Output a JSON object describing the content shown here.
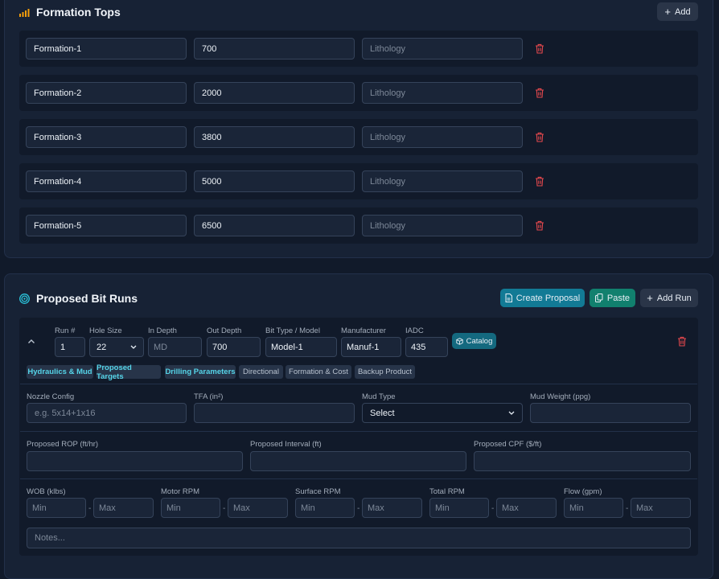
{
  "formation_tops": {
    "title": "Formation Tops",
    "add_label": "Add",
    "rows": [
      {
        "name": "Formation-1",
        "depth": "700",
        "lithology_placeholder": "Lithology"
      },
      {
        "name": "Formation-2",
        "depth": "2000",
        "lithology_placeholder": "Lithology"
      },
      {
        "name": "Formation-3",
        "depth": "3800",
        "lithology_placeholder": "Lithology"
      },
      {
        "name": "Formation-4",
        "depth": "5000",
        "lithology_placeholder": "Lithology"
      },
      {
        "name": "Formation-5",
        "depth": "6500",
        "lithology_placeholder": "Lithology"
      }
    ]
  },
  "bit_runs": {
    "title": "Proposed Bit Runs",
    "create_label": "Create Proposal",
    "paste_label": "Paste",
    "add_run_label": "Add Run",
    "run": {
      "labels": {
        "run": "Run #",
        "hole": "Hole Size",
        "in_depth": "In Depth",
        "out_depth": "Out Depth",
        "bit_type": "Bit Type / Model",
        "manufacturer": "Manufacturer",
        "iadc": "IADC"
      },
      "values": {
        "run": "1",
        "hole": "22",
        "in_depth_placeholder": "MD",
        "out_depth": "700",
        "bit_type": "Model-1",
        "manufacturer": "Manuf-1",
        "iadc": "435"
      },
      "catalog_label": "Catalog",
      "tabs": [
        "Hydraulics & Mud",
        "Proposed Targets",
        "Drilling Parameters",
        "Directional",
        "Formation & Cost",
        "Backup Product"
      ],
      "fields": {
        "nozzle_label": "Nozzle Config",
        "nozzle_placeholder": "e.g. 5x14+1x16",
        "tfa_label": "TFA (in²)",
        "mud_type_label": "Mud Type",
        "mud_type_value": "Select",
        "mud_weight_label": "Mud Weight (ppg)",
        "rop_label": "Proposed ROP (ft/hr)",
        "interval_label": "Proposed Interval (ft)",
        "cpf_label": "Proposed CPF ($/ft)",
        "wob_label": "WOB (klbs)",
        "motor_label": "Motor RPM",
        "surface_label": "Surface RPM",
        "total_label": "Total RPM",
        "flow_label": "Flow (gpm)",
        "min_placeholder": "Min",
        "max_placeholder": "Max",
        "dash": "-",
        "notes_placeholder": "Notes..."
      }
    }
  },
  "colors": {
    "accent_teal": "#127a95",
    "accent_green": "#11806e",
    "trash_red": "#e5484d",
    "icon_orange": "#f59e0b"
  }
}
